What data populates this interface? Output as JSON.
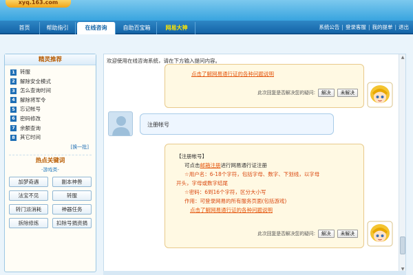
{
  "logo": {
    "text": "xyq.163.com"
  },
  "nav": {
    "tabs": [
      {
        "label": "首页",
        "active": false
      },
      {
        "label": "帮助指引",
        "active": false
      },
      {
        "label": "在线咨询",
        "active": true
      },
      {
        "label": "自助百宝箱",
        "active": false
      },
      {
        "label": "网易大神",
        "highlight": true
      }
    ],
    "right_links": [
      "系统公告",
      "登录客服",
      "我的提单",
      "退出"
    ]
  },
  "sidebar": {
    "title": "精灵推荐",
    "items": [
      {
        "num": "1",
        "label": "转服"
      },
      {
        "num": "2",
        "label": "解除安全模式"
      },
      {
        "num": "3",
        "label": "怎么查询时间"
      },
      {
        "num": "4",
        "label": "解除将军令"
      },
      {
        "num": "5",
        "label": "忘记帐号"
      },
      {
        "num": "6",
        "label": "密码修改"
      },
      {
        "num": "7",
        "label": "余额查询"
      },
      {
        "num": "8",
        "label": "其它时间"
      }
    ],
    "switch_label": "[换一批]",
    "hot_title": "热点关键词",
    "hot_subtitle": "-游戏类-",
    "keywords": [
      "加梦奇遇",
      "副本神兽",
      "法宝不见",
      "转服",
      "转门派消耗",
      "神器任务",
      "拆除修炼",
      "扣除号捐资捐"
    ]
  },
  "chat": {
    "welcome": "欢迎使用在线咨询系统，请在下方输入提问内容。",
    "msg1": {
      "link": "点击了解网易通行证的各种问题说明",
      "feedback_question": "此次回复是否解决您的疑问:",
      "solved": "解决",
      "unsolved": "未解决"
    },
    "user_msg": "注册帐号",
    "msg2": {
      "title": "【注册帐号】",
      "line1_prefix": "可点击",
      "line1_link": "邮箱注册",
      "line1_suffix": "进行网易通行证注册",
      "line2": "☆用户名：6-18个字符，包括字母、数字、下划线，以字母",
      "line3": "开头，字母或数字结尾",
      "line4": "☆密码：6到16个字符，区分大小写",
      "line5": "作用：可登录网易的所有服务页面(包括游戏)",
      "link": "点击了解网易通行证的各种问题说明",
      "feedback_question": "此次回复是否解决您的疑问:",
      "solved": "解决",
      "unsolved": "未解决"
    }
  },
  "colors": {
    "accent": "#1565a8",
    "link": "#e4560e",
    "title": "#b85b00"
  }
}
